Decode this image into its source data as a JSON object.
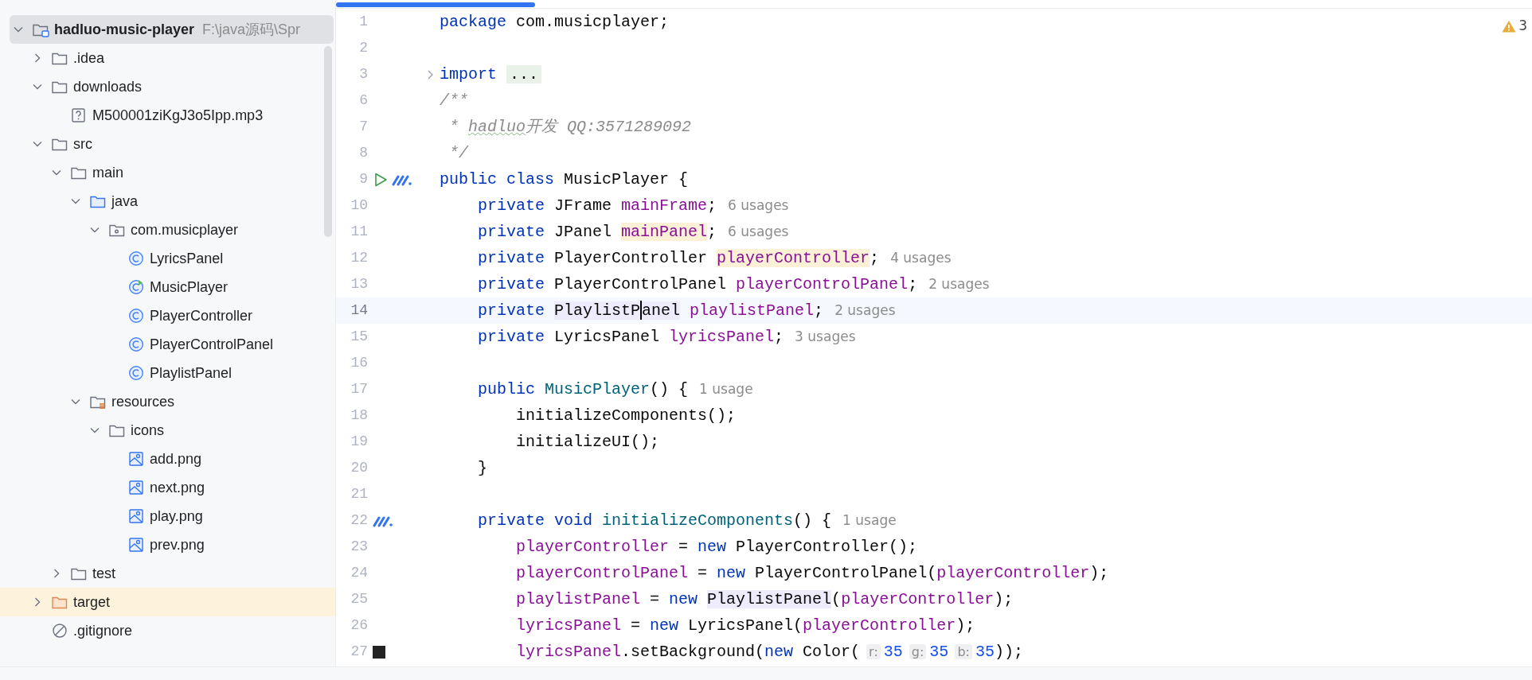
{
  "project_tree": [
    {
      "label": "hadluo-music-player",
      "path": "F:\\java源码\\Spr",
      "kind": "module",
      "expanded": true,
      "selected": true,
      "children": [
        {
          "label": ".idea",
          "kind": "folder",
          "expanded": false,
          "selected": false
        },
        {
          "label": "downloads",
          "kind": "folder",
          "expanded": true,
          "selected": false,
          "children": [
            {
              "label": "M500001ziKgJ3o5Ipp.mp3",
              "kind": "unknown-file",
              "selected": false
            }
          ]
        },
        {
          "label": "src",
          "kind": "folder",
          "expanded": true,
          "selected": false,
          "children": [
            {
              "label": "main",
              "kind": "folder",
              "expanded": true,
              "selected": false,
              "children": [
                {
                  "label": "java",
                  "kind": "source-folder",
                  "expanded": true,
                  "selected": false,
                  "children": [
                    {
                      "label": "com.musicplayer",
                      "kind": "package",
                      "expanded": true,
                      "selected": false,
                      "children": [
                        {
                          "label": "LyricsPanel",
                          "kind": "class",
                          "selected": false
                        },
                        {
                          "label": "MusicPlayer",
                          "kind": "main-class",
                          "selected": false
                        },
                        {
                          "label": "PlayerController",
                          "kind": "class",
                          "selected": false
                        },
                        {
                          "label": "PlayerControlPanel",
                          "kind": "class",
                          "selected": false
                        },
                        {
                          "label": "PlaylistPanel",
                          "kind": "class",
                          "selected": false
                        }
                      ]
                    }
                  ]
                },
                {
                  "label": "resources",
                  "kind": "resources-folder",
                  "expanded": true,
                  "selected": false,
                  "children": [
                    {
                      "label": "icons",
                      "kind": "folder",
                      "expanded": true,
                      "selected": false,
                      "children": [
                        {
                          "label": "add.png",
                          "kind": "image",
                          "selected": false
                        },
                        {
                          "label": "next.png",
                          "kind": "image",
                          "selected": false
                        },
                        {
                          "label": "play.png",
                          "kind": "image",
                          "selected": false
                        },
                        {
                          "label": "prev.png",
                          "kind": "image",
                          "selected": false
                        }
                      ]
                    }
                  ]
                }
              ]
            },
            {
              "label": "test",
              "kind": "folder",
              "expanded": false,
              "selected": false
            }
          ]
        },
        {
          "label": "target",
          "kind": "excluded-folder",
          "expanded": false,
          "selected": false
        },
        {
          "label": ".gitignore",
          "kind": "ignore-file",
          "selected": false
        }
      ]
    }
  ],
  "editor": {
    "warnings": "3",
    "lines": [
      {
        "number": "1",
        "tokens": [
          {
            "kind": "keyword",
            "text": "package"
          },
          {
            "kind": "plain",
            "text": " com.musicplayer;"
          }
        ]
      },
      {
        "number": "2"
      },
      {
        "number": "3",
        "folded": true,
        "tokens": [
          {
            "kind": "keyword",
            "text": "import "
          },
          {
            "kind": "fold",
            "text": "..."
          }
        ]
      },
      {
        "number": "6",
        "tokens": [
          {
            "kind": "comment",
            "text": "/**"
          }
        ]
      },
      {
        "number": "7",
        "tokens": [
          {
            "kind": "comment",
            "text": " * "
          },
          {
            "kind": "comment",
            "text": "hadluo",
            "typo": true
          },
          {
            "kind": "comment",
            "text": "开发 QQ:3571289092"
          }
        ]
      },
      {
        "number": "8",
        "tokens": [
          {
            "kind": "comment",
            "text": " */"
          }
        ]
      },
      {
        "number": "9",
        "gutter": [
          {
            "kind": "run"
          },
          {
            "kind": "method-mark"
          }
        ],
        "tokens": [
          {
            "kind": "keyword",
            "text": "public class"
          },
          {
            "kind": "plain",
            "text": " MusicPlayer {"
          }
        ]
      },
      {
        "number": "10",
        "tokens": [
          {
            "kind": "keyword",
            "text": "    private"
          },
          {
            "kind": "plain",
            "text": " JFrame "
          },
          {
            "kind": "field",
            "text": "mainFrame"
          },
          {
            "kind": "plain",
            "text": ";"
          }
        ],
        "hint": "6 usages"
      },
      {
        "number": "11",
        "tokens": [
          {
            "kind": "keyword",
            "text": "    private"
          },
          {
            "kind": "plain",
            "text": " JPanel "
          },
          {
            "kind": "field",
            "text": "mainPanel",
            "read_highlight": true
          },
          {
            "kind": "plain",
            "text": ";"
          }
        ],
        "hint": "6 usages"
      },
      {
        "number": "12",
        "tokens": [
          {
            "kind": "keyword",
            "text": "    private"
          },
          {
            "kind": "plain",
            "text": " PlayerController "
          },
          {
            "kind": "field",
            "text": "playerController",
            "read_highlight": true
          },
          {
            "kind": "plain",
            "text": ";"
          }
        ],
        "hint": "4 usages"
      },
      {
        "number": "13",
        "tokens": [
          {
            "kind": "keyword",
            "text": "    private"
          },
          {
            "kind": "plain",
            "text": " PlayerControlPanel "
          },
          {
            "kind": "field",
            "text": "playerControlPanel"
          },
          {
            "kind": "plain",
            "text": ";"
          }
        ],
        "hint": "2 usages"
      },
      {
        "number": "14",
        "current": true,
        "tokens": [
          {
            "kind": "keyword",
            "text": "    private "
          },
          {
            "kind": "plain",
            "text": "PlaylistP",
            "symbol_highlight": true
          },
          {
            "kind": "caret"
          },
          {
            "kind": "plain",
            "text": "anel",
            "symbol_highlight": true
          },
          {
            "kind": "field",
            "text": " playlistPanel"
          },
          {
            "kind": "plain",
            "text": ";"
          }
        ],
        "hint": "2 usages"
      },
      {
        "number": "15",
        "tokens": [
          {
            "kind": "keyword",
            "text": "    private"
          },
          {
            "kind": "plain",
            "text": " LyricsPanel "
          },
          {
            "kind": "field",
            "text": "lyricsPanel"
          },
          {
            "kind": "plain",
            "text": ";"
          }
        ],
        "hint": "3 usages"
      },
      {
        "number": "16"
      },
      {
        "number": "17",
        "tokens": [
          {
            "kind": "keyword",
            "text": "    public "
          },
          {
            "kind": "method",
            "text": "MusicPlayer"
          },
          {
            "kind": "plain",
            "text": "() {"
          }
        ],
        "hint": "1 usage"
      },
      {
        "number": "18",
        "tokens": [
          {
            "kind": "plain",
            "text": "        initializeComponents();"
          }
        ]
      },
      {
        "number": "19",
        "tokens": [
          {
            "kind": "plain",
            "text": "        initializeUI();"
          }
        ]
      },
      {
        "number": "20",
        "tokens": [
          {
            "kind": "plain",
            "text": "    }"
          }
        ]
      },
      {
        "number": "21"
      },
      {
        "number": "22",
        "gutter": [
          {
            "kind": "method-mark"
          }
        ],
        "tokens": [
          {
            "kind": "keyword",
            "text": "    private void "
          },
          {
            "kind": "method",
            "text": "initializeComponents"
          },
          {
            "kind": "plain",
            "text": "() {"
          }
        ],
        "hint": "1 usage"
      },
      {
        "number": "23",
        "tokens": [
          {
            "kind": "field",
            "text": "        playerController"
          },
          {
            "kind": "plain",
            "text": " = "
          },
          {
            "kind": "keyword",
            "text": "new"
          },
          {
            "kind": "plain",
            "text": " PlayerController();"
          }
        ]
      },
      {
        "number": "24",
        "tokens": [
          {
            "kind": "field",
            "text": "        playerControlPanel"
          },
          {
            "kind": "plain",
            "text": " = "
          },
          {
            "kind": "keyword",
            "text": "new"
          },
          {
            "kind": "plain",
            "text": " PlayerControlPanel("
          },
          {
            "kind": "field",
            "text": "playerController"
          },
          {
            "kind": "plain",
            "text": ");"
          }
        ]
      },
      {
        "number": "25",
        "tokens": [
          {
            "kind": "field",
            "text": "        playlistPanel"
          },
          {
            "kind": "plain",
            "text": " = "
          },
          {
            "kind": "keyword",
            "text": "new "
          },
          {
            "kind": "plain",
            "text": "PlaylistPanel",
            "symbol_highlight": true
          },
          {
            "kind": "plain",
            "text": "("
          },
          {
            "kind": "field",
            "text": "playerController"
          },
          {
            "kind": "plain",
            "text": ");"
          }
        ]
      },
      {
        "number": "26",
        "tokens": [
          {
            "kind": "field",
            "text": "        lyricsPanel"
          },
          {
            "kind": "plain",
            "text": " = "
          },
          {
            "kind": "keyword",
            "text": "new"
          },
          {
            "kind": "plain",
            "text": " LyricsPanel("
          },
          {
            "kind": "field",
            "text": "playerController"
          },
          {
            "kind": "plain",
            "text": ");"
          }
        ]
      },
      {
        "number": "27",
        "gutter": [
          {
            "kind": "color-swatch"
          }
        ],
        "tokens": [
          {
            "kind": "field",
            "text": "        lyricsPanel"
          },
          {
            "kind": "plain",
            "text": ".setBackground("
          },
          {
            "kind": "keyword",
            "text": "new"
          },
          {
            "kind": "plain",
            "text": " Color("
          },
          {
            "kind": "param",
            "text": "r:"
          },
          {
            "kind": "number",
            "text": "35"
          },
          {
            "kind": "param",
            "text": "g:"
          },
          {
            "kind": "number",
            "text": "35"
          },
          {
            "kind": "param",
            "text": "b:"
          },
          {
            "kind": "number",
            "text": "35"
          },
          {
            "kind": "plain",
            "text": "));"
          }
        ]
      }
    ]
  }
}
